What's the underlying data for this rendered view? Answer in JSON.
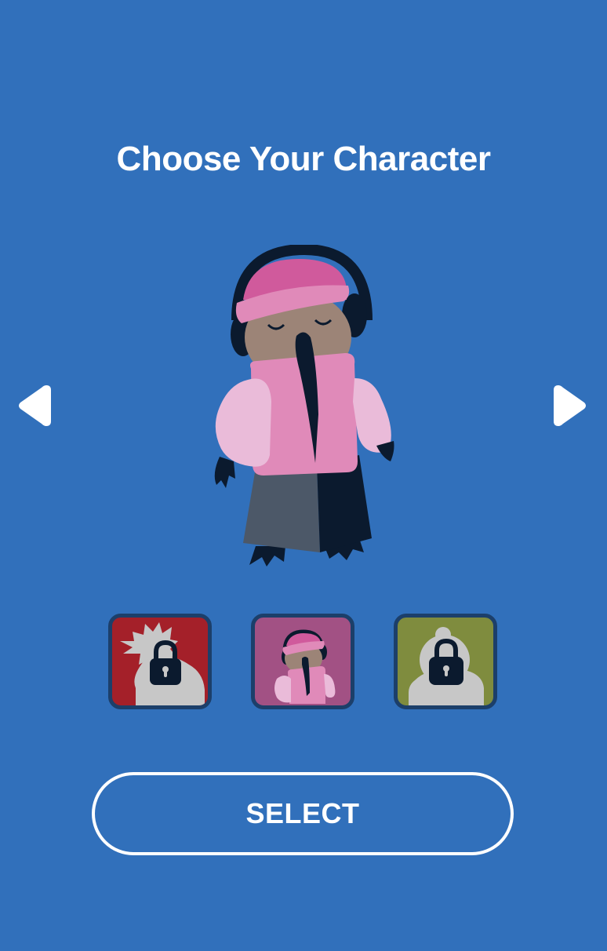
{
  "screen": {
    "title": "Choose Your Character",
    "background_color": "#3170BB"
  },
  "navigation": {
    "prev_icon": "triangle-left-icon",
    "next_icon": "triangle-right-icon"
  },
  "selected_character": {
    "description_icon": "kiwi-bird-pink-vest-character"
  },
  "character_slots": [
    {
      "color": "#A42029",
      "locked": true,
      "icon": "lock-icon"
    },
    {
      "color": "#A25184",
      "locked": false,
      "selected": true
    },
    {
      "color": "#7F8C3E",
      "locked": true,
      "icon": "lock-icon"
    }
  ],
  "actions": {
    "select_label": "SELECT"
  }
}
